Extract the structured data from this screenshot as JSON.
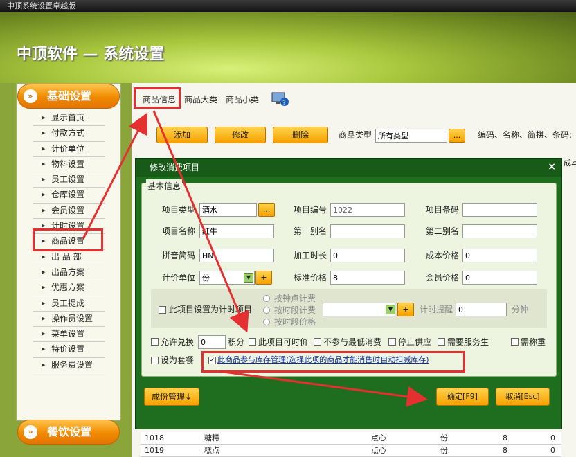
{
  "window_title": "中顶系统设置卓越版",
  "header_title": "中顶软件 — 系统设置",
  "sidebar": {
    "category_top": "基础设置",
    "items": [
      "显示首页",
      "付款方式",
      "计价单位",
      "物料设置",
      "员工设置",
      "仓库设置",
      "会员设置",
      "计时设置",
      "商品设置",
      "出 品 部",
      "出品方案",
      "优惠方案",
      "员工提成",
      "操作员设置",
      "菜单设置",
      "特价设置",
      "服务费设置"
    ],
    "category_bottom": "餐饮设置"
  },
  "tabs": [
    "商品信息",
    "商品大类",
    "商品小类"
  ],
  "toolbar": {
    "add": "添加",
    "edit": "修改",
    "delete": "删除",
    "type_label": "商品类型",
    "type_value": "所有类型",
    "browse": "...",
    "search_label": "编码、名称、简拼、条码:",
    "cost_col": "成本"
  },
  "dialog": {
    "title": "修改消费项目",
    "close": "×",
    "group_label": "基本信息",
    "fields": {
      "type_label": "项目类型",
      "type_value": "酒水",
      "code_label": "项目编号",
      "code_value": "1022",
      "barcode_label": "项目条码",
      "barcode_value": "",
      "name_label": "项目名称",
      "name_value": "红牛",
      "alias1_label": "第一别名",
      "alias1_value": "",
      "alias2_label": "第二别名",
      "alias2_value": "",
      "pinyin_label": "拼音简码",
      "pinyin_value": "HN",
      "duration_label": "加工时长",
      "duration_value": "0",
      "cost_label": "成本价格",
      "cost_value": "0",
      "unit_label": "计价单位",
      "unit_value": "份",
      "price_label": "标准价格",
      "price_value": "8",
      "member_label": "会员价格",
      "member_value": "0"
    },
    "timed": {
      "checkbox": "此项目设置为计时项目",
      "radio1": "按钟点计费",
      "radio2": "按时段计费",
      "radio3": "按时段价格",
      "remind_label": "计时提醒",
      "remind_value": "0",
      "minutes": "分钟"
    },
    "options": {
      "allow_exchange": "允许兑换",
      "points_value": "0",
      "points_label": "积分",
      "time_price": "此项目可时价",
      "no_min": "不参与最低消费",
      "stop_supply": "停止供应",
      "need_service": "需要服务生",
      "need_weigh": "需称重",
      "set_package": "设为套餐",
      "inventory": "此商品参与库存管理(选择此项的商品才能消售时自动扣减库存)"
    },
    "component_btn": "成份管理↓",
    "ok_btn": "确定[F9]",
    "cancel_btn": "取消[Esc]"
  },
  "table": {
    "rows": [
      {
        "code": "1018",
        "name": "糖糕",
        "cat": "点心",
        "unit": "份",
        "price": "8",
        "cost": "0"
      },
      {
        "code": "1019",
        "name": "糕点",
        "cat": "点心",
        "unit": "份",
        "price": "8",
        "cost": "0"
      }
    ]
  },
  "colors": {
    "accent": "#f7a000",
    "dialog": "#1f6e1f",
    "highlight": "#e43030",
    "header": "#a9c73e"
  }
}
